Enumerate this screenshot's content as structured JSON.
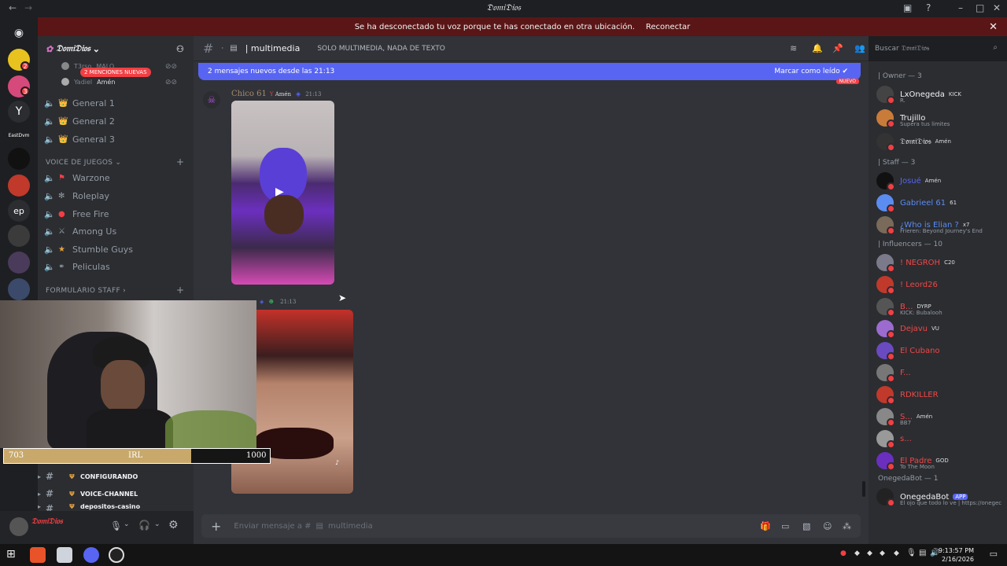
{
  "window": {
    "title": "𝔇𝔬𝔪𝔦𝔇𝔦𝔬𝔰",
    "back_icon": "arrow-left-icon",
    "forward_icon": "arrow-right-icon"
  },
  "banner": {
    "text": "Se ha desconectado tu voz porque te has conectado en otra ubicación.",
    "action": "Reconectar",
    "color": "#5a1616"
  },
  "servers": {
    "badges": [
      "2",
      "3"
    ],
    "labels": [
      "EastDvm",
      "ep"
    ]
  },
  "sidebar": {
    "server_name": "𝔇𝔬𝔪𝔦𝔇𝔦𝔬𝔰",
    "mentions_pill": "2 MENCIONES NUEVAS",
    "voice_users": [
      {
        "name": "T3rso",
        "tag": "MALO"
      },
      {
        "name": "Yadiel",
        "tag": "Amén"
      }
    ],
    "general_channels": [
      "General 1",
      "General 2",
      "General 3"
    ],
    "category_juegos": "VOICE DE JUEGOS",
    "game_channels": [
      "Warzone",
      "Roleplay",
      "Free Fire",
      "Among Us",
      "Stumble Guys",
      "Peliculas"
    ],
    "category_staff": "FORMULARIO STAFF",
    "lower_channels": [
      "CONFIGURANDO",
      "VOICE-CHANNEL",
      "depositos-casino"
    ]
  },
  "header": {
    "channel": "| multimedia",
    "topic": "SOLO MULTIMEDIA, NADA DE TEXTO",
    "search_placeholder": "Buscar 𝔇𝔬𝔪𝔦𝔇𝔦𝔬𝔰"
  },
  "main": {
    "new_messages": "2 mensajes nuevos desde las 21:13",
    "mark_read": "Marcar como leído",
    "new_tag": "NUEVO",
    "messages": [
      {
        "author": "Chico 61",
        "tag": "Amén",
        "time": "21:13"
      },
      {
        "author": "",
        "tag": "",
        "time": "21:13"
      }
    ]
  },
  "composer": {
    "placeholder": "Enviar mensaje a #",
    "channel": "multimedia"
  },
  "user": {
    "name": "𝔇𝔬𝔪𝔦𝔇𝔦𝔬𝔰"
  },
  "overlay": {
    "current": "703",
    "label": "IRL",
    "goal": "1000",
    "progress_fraction": 0.703
  },
  "members": {
    "owner_cat": "| Owner — 3",
    "owner": [
      {
        "name": "LxOnegeda",
        "badge": "KICK",
        "sub": "R.",
        "color": "#f2f3f5"
      },
      {
        "name": "Trujillo",
        "badge": "",
        "sub": "Supera tus limites",
        "color": "#f2f3f5"
      },
      {
        "name": "𝔇𝔬𝔪𝔦𝔇𝔦𝔬𝔰",
        "badge": "Amén",
        "sub": "",
        "color": "#f2f3f5"
      }
    ],
    "staff_cat": "| Staff — 3",
    "staff": [
      {
        "name": "Josué",
        "badge": "Amén",
        "sub": "",
        "color": "#5865f2"
      },
      {
        "name": "Gabrieel 61",
        "badge": "61",
        "sub": "",
        "color": "#5b8cf2"
      },
      {
        "name": "¿Who is Elian ?",
        "badge": "x7",
        "sub": "Frieren: Beyond Journey's End",
        "color": "#5b8cf2"
      }
    ],
    "influ_cat": "| Influencers — 10",
    "influencers": [
      {
        "name": "! NEGROH",
        "badge": "C20",
        "sub": "",
        "color": "#f04747"
      },
      {
        "name": "! Leord26",
        "badge": "",
        "sub": "",
        "color": "#f04747"
      },
      {
        "name": "B...",
        "badge": "DYRP",
        "sub": "KICK: Bubalooh",
        "color": "#f04747"
      },
      {
        "name": "Dejavu",
        "badge": "VU",
        "sub": "",
        "color": "#f04747"
      },
      {
        "name": "El Cubano",
        "badge": "",
        "sub": "",
        "color": "#f04747"
      },
      {
        "name": "F...",
        "badge": "",
        "sub": "",
        "color": "#f04747"
      },
      {
        "name": "RDKILLER",
        "badge": "",
        "sub": "",
        "color": "#f04747"
      },
      {
        "name": "S...",
        "badge": "Amén",
        "sub": "BB7",
        "color": "#f04747"
      },
      {
        "name": "s...",
        "badge": "",
        "sub": "",
        "color": "#f04747"
      },
      {
        "name": "El Padre",
        "badge": "GOD",
        "sub": "To The Moon",
        "color": "#f04747"
      }
    ],
    "bot_cat": "OnegedaBot — 1",
    "bots": [
      {
        "name": "OnegedaBot",
        "badge": "APP",
        "sub": "El ojo que todo lo ve | https://onegec",
        "color": "#f2f3f5"
      }
    ]
  },
  "taskbar": {
    "time": "9:13:57 PM",
    "date": "2/16/2026"
  }
}
